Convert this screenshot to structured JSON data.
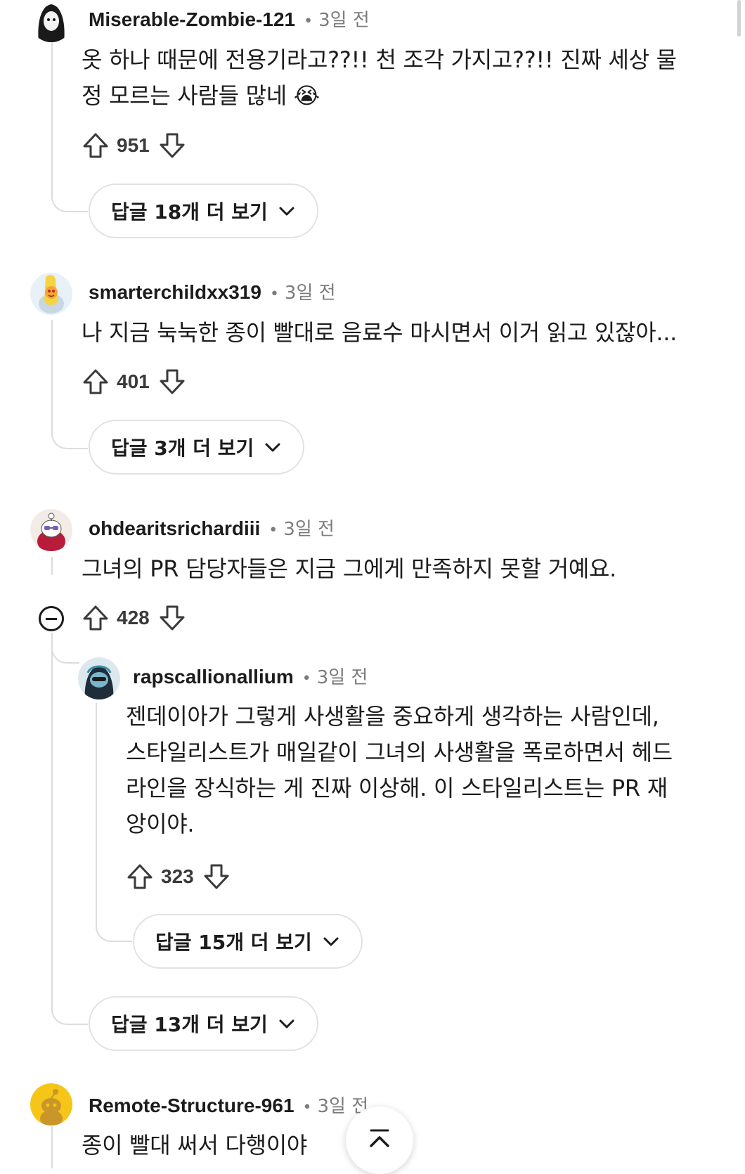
{
  "comments": [
    {
      "username": "Miserable-Zombie-121",
      "time": "3일 전",
      "body_lines": [
        "옷 하나 때문에 전용기라고??!! 천 조각 가지고??!! 진짜 세상 물",
        "정 모르는 사람들 많네 😭"
      ],
      "score": "951",
      "more_replies": "답글 18개 더 보기"
    },
    {
      "username": "smarterchildxx319",
      "time": "3일 전",
      "body_lines": [
        "나 지금 눅눅한 종이 빨대로 음료수 마시면서 이거 읽고 있잖아..."
      ],
      "score": "401",
      "more_replies": "답글 3개 더 보기"
    },
    {
      "username": "ohdearitsrichardiii",
      "time": "3일 전",
      "body_lines": [
        "그녀의 PR 담당자들은 지금 그에게 만족하지 못할 거예요."
      ],
      "score": "428",
      "more_replies": "답글 13개 더 보기",
      "reply": {
        "username": "rapscallionallium",
        "time": "3일 전",
        "body_lines": [
          "젠데이아가 그렇게 사생활을 중요하게 생각하는 사람인데,",
          "스타일리스트가 매일같이 그녀의 사생활을 폭로하면서 헤드",
          "라인을 장식하는 게 진짜 이상해. 이 스타일리스트는 PR 재",
          "앙이야."
        ],
        "score": "323",
        "more_replies": "답글 15개 더 보기"
      }
    },
    {
      "username": "Remote-Structure-961",
      "time": "3일 전",
      "body_lines": [
        "종이 빨대 써서 다행이야"
      ]
    }
  ],
  "icons": {
    "upvote": "arrow-up-outline-icon",
    "downvote": "arrow-down-outline-icon",
    "expand": "chevron-down-icon",
    "collapse": "minus-circle-icon",
    "back_to_top": "chevron-up-icon"
  },
  "colors": {
    "text": "#1c1c1c",
    "meta": "#7c7c7c",
    "thread_line": "#dcdcdc",
    "pill_border": "#e2e2e2"
  }
}
